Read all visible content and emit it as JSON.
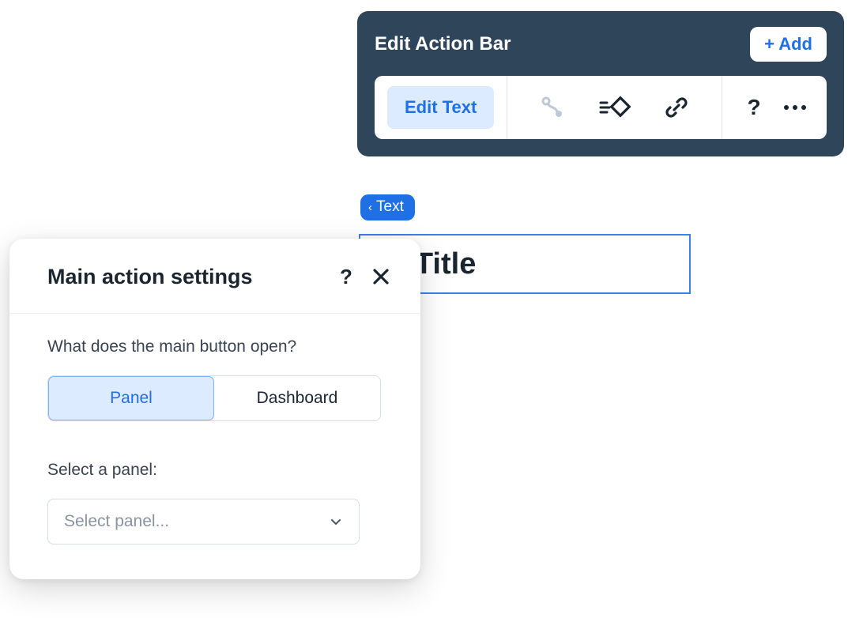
{
  "actionBar": {
    "title": "Edit Action Bar",
    "addLabel": "+ Add",
    "editTextLabel": "Edit Text"
  },
  "textPill": {
    "label": "Text"
  },
  "titleBox": {
    "text": "ox Title"
  },
  "settings": {
    "title": "Main action settings",
    "question": "What does the main button open?",
    "toggle": {
      "panel": "Panel",
      "dashboard": "Dashboard",
      "selected": "panel"
    },
    "selectLabel": "Select a panel:",
    "selectPlaceholder": "Select panel..."
  },
  "colors": {
    "primary": "#1F6FE5",
    "darkSurface": "#2F4559",
    "selectedBg": "#DCEBFF"
  }
}
